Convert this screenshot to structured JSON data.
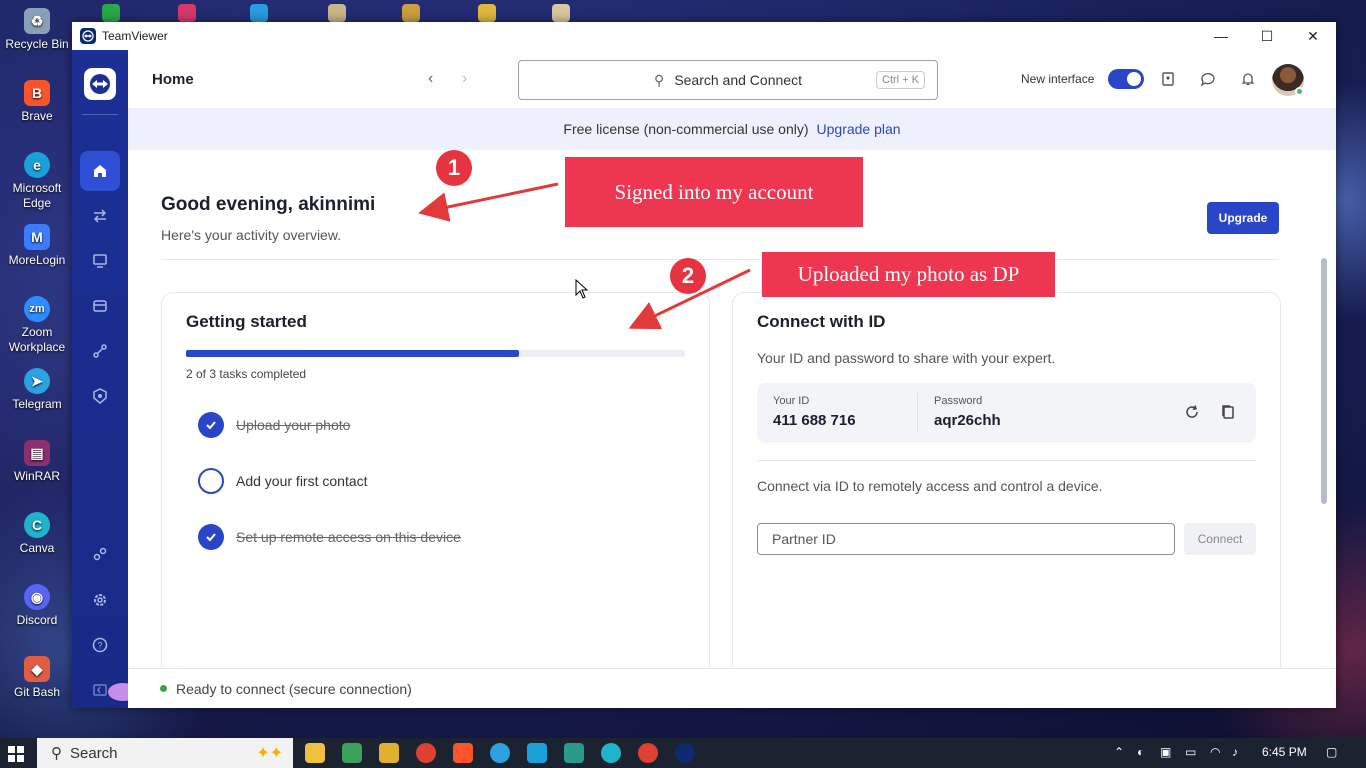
{
  "desktop": {
    "icons": [
      {
        "label": "Recycle Bin",
        "color": "#8aa0b8"
      },
      {
        "label": "Brave",
        "color": "#fb542b"
      },
      {
        "label": "Microsoft Edge",
        "color": "#1aa0d8"
      },
      {
        "label": "MoreLogin",
        "color": "#3c7bff"
      },
      {
        "label": "Zoom Workplace",
        "color": "#2d8cff"
      },
      {
        "label": "Telegram",
        "color": "#2aa3e0"
      },
      {
        "label": "WinRAR",
        "color": "#8b2f6e"
      },
      {
        "label": "Canva",
        "color": "#20b3c9"
      },
      {
        "label": "Discord",
        "color": "#5865f2"
      },
      {
        "label": "Git Bash",
        "color": "#e05d44"
      }
    ]
  },
  "window": {
    "title": "TeamViewer",
    "controls": {
      "minimize": "—",
      "maximize": "☐",
      "close": "✕"
    }
  },
  "sidebar": {
    "items": [
      {
        "name": "home-icon",
        "active": true
      },
      {
        "name": "transfer-icon",
        "active": false
      },
      {
        "name": "remote-desktop-icon",
        "active": false
      },
      {
        "name": "devices-icon",
        "active": false
      },
      {
        "name": "workflow-icon",
        "active": false
      },
      {
        "name": "security-icon",
        "active": false
      },
      {
        "name": "integrations-icon",
        "active": false
      },
      {
        "name": "settings-icon",
        "active": false
      },
      {
        "name": "help-icon",
        "active": false
      },
      {
        "name": "collapse-icon",
        "active": false
      }
    ]
  },
  "header": {
    "title": "Home",
    "search_placeholder": "Search and Connect",
    "search_shortcut": "Ctrl + K",
    "new_interface_label": "New interface",
    "new_interface_on": true
  },
  "banner": {
    "text": "Free license (non-commercial use only)",
    "link": "Upgrade plan"
  },
  "greeting": {
    "title": "Good evening, akinnimi",
    "subtitle": "Here's your activity overview.",
    "upgrade_label": "Upgrade"
  },
  "getting_started": {
    "title": "Getting started",
    "progress": 0.667,
    "progress_text": "2 of 3 tasks completed",
    "tasks": [
      {
        "label": "Upload your photo",
        "done": true
      },
      {
        "label": "Add your first contact",
        "done": false
      },
      {
        "label": "Set up remote access on this device",
        "done": true
      }
    ]
  },
  "connect": {
    "title": "Connect with ID",
    "subtitle": "Your ID and password to share with your expert.",
    "id_label": "Your ID",
    "id_value": "411 688 716",
    "password_label": "Password",
    "password_value": "aqr26chh",
    "via_text": "Connect via ID to remotely access and control a device.",
    "partner_placeholder": "Partner ID",
    "connect_label": "Connect"
  },
  "status": {
    "text": "Ready to connect (secure connection)",
    "color": "#2ea84a"
  },
  "annotations": {
    "one": {
      "number": "1",
      "text": "Signed into my account"
    },
    "two": {
      "number": "2",
      "text": "Uploaded my photo as DP"
    }
  },
  "taskbar": {
    "search_label": "Search",
    "time": "6:45 PM"
  },
  "colors": {
    "accent": "#2a46c8",
    "sidebar": "#1b2f95",
    "annotation": "#ee3650"
  }
}
